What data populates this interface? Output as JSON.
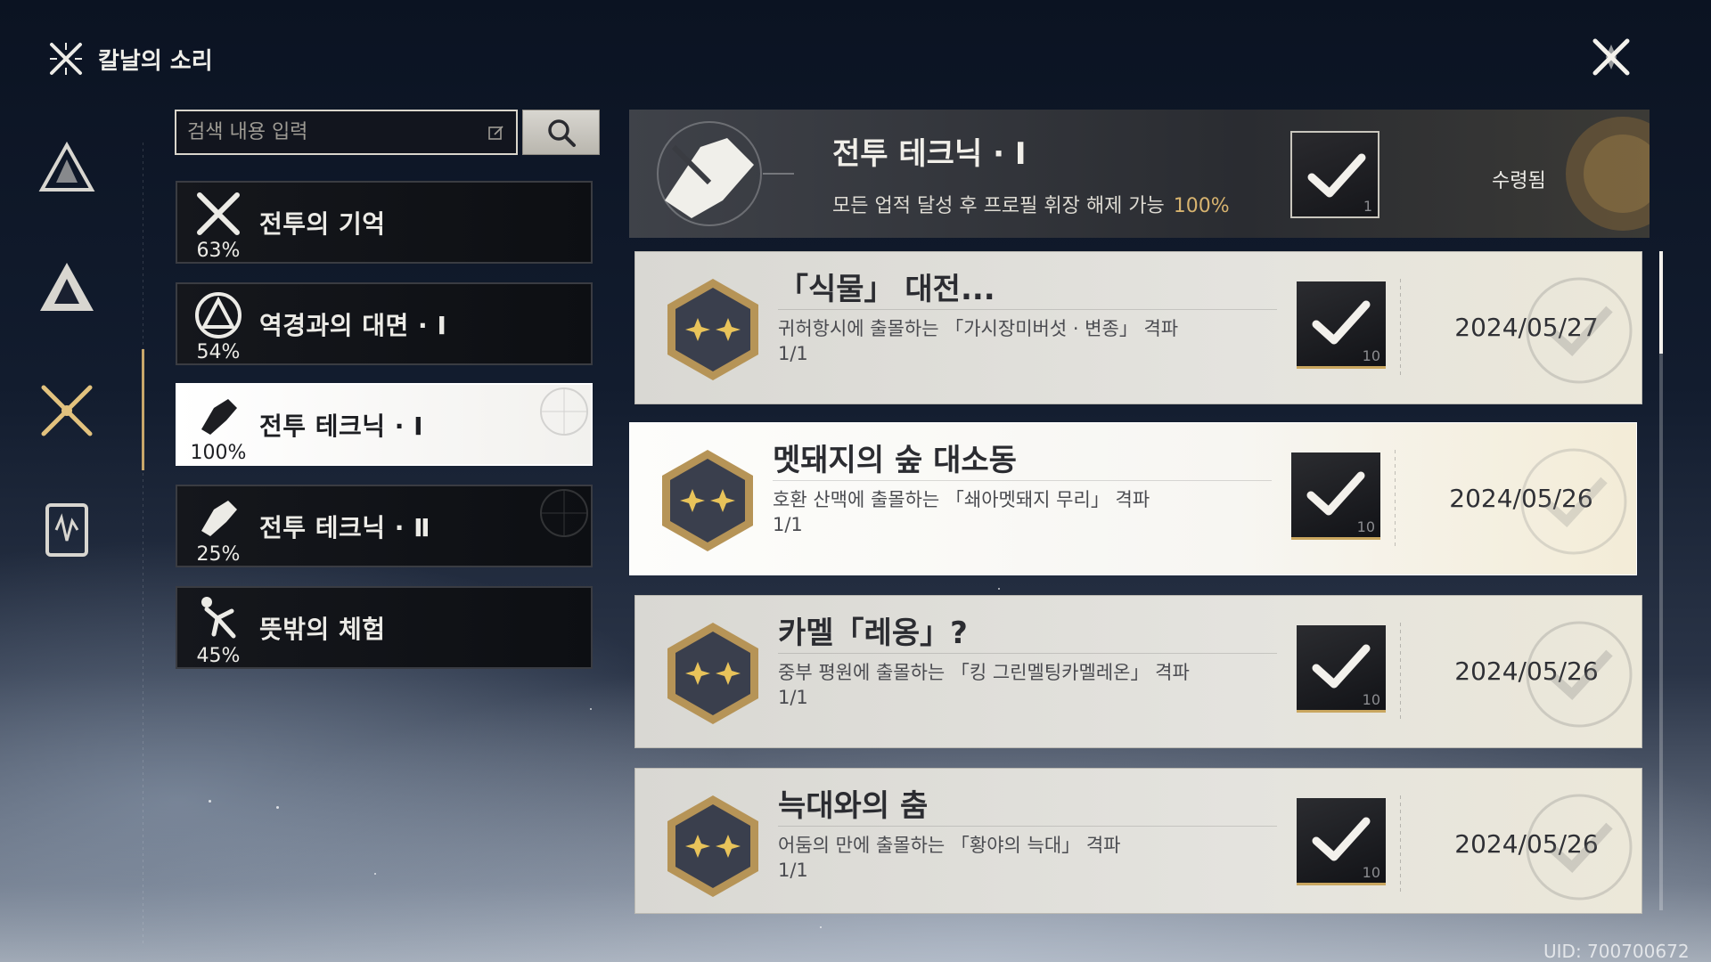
{
  "app": {
    "title": "칼날의 소리"
  },
  "search": {
    "placeholder": "검색 내용 입력"
  },
  "categories": [
    {
      "label": "전투의 기억",
      "percent": "63%",
      "icon": "crossed-swords-icon"
    },
    {
      "label": "역경과의 대면 · Ⅰ",
      "percent": "54%",
      "icon": "triangle-emblem-icon"
    },
    {
      "label": "전투 테크닉 · Ⅰ",
      "percent": "100%",
      "icon": "fist-icon",
      "active": true
    },
    {
      "label": "전투 테크닉 · Ⅱ",
      "percent": "25%",
      "icon": "fist-icon"
    },
    {
      "label": "뜻밖의 체험",
      "percent": "45%",
      "icon": "tripping-figure-icon"
    }
  ],
  "summary": {
    "title": "전투 테크닉 · Ⅰ",
    "subtitle": "모든 업적 달성 후 프로필 휘장 해제 가능",
    "percent": "100%",
    "reward_qty": "1",
    "status": "수령됨"
  },
  "achievements": [
    {
      "name": "「식물」 대전...",
      "desc": "귀허항시에 출몰하는 「가시장미버섯 · 변종」 격파",
      "progress": "1/1",
      "reward_qty": "10",
      "date": "2024/05/27"
    },
    {
      "name": "멧돼지의 숲 대소동",
      "desc": "호환 산맥에 출몰하는 「쇄아멧돼지 무리」 격파",
      "progress": "1/1",
      "reward_qty": "10",
      "date": "2024/05/26"
    },
    {
      "name": "카멜「레옹」?",
      "desc": "중부 평원에 출몰하는 「킹 그린멜팅카멜레온」 격파",
      "progress": "1/1",
      "reward_qty": "10",
      "date": "2024/05/26"
    },
    {
      "name": "늑대와의 춤",
      "desc": "어둠의 만에 출몰하는 「황야의 늑대」 격파",
      "progress": "1/1",
      "reward_qty": "10",
      "date": "2024/05/26"
    }
  ],
  "uid": "UID: 700700672",
  "colors": {
    "accent_gold": "#c8a76a",
    "percent_gold": "#d7b36f",
    "panel_dark": "#15171c",
    "row_light": "#e4e3de"
  }
}
